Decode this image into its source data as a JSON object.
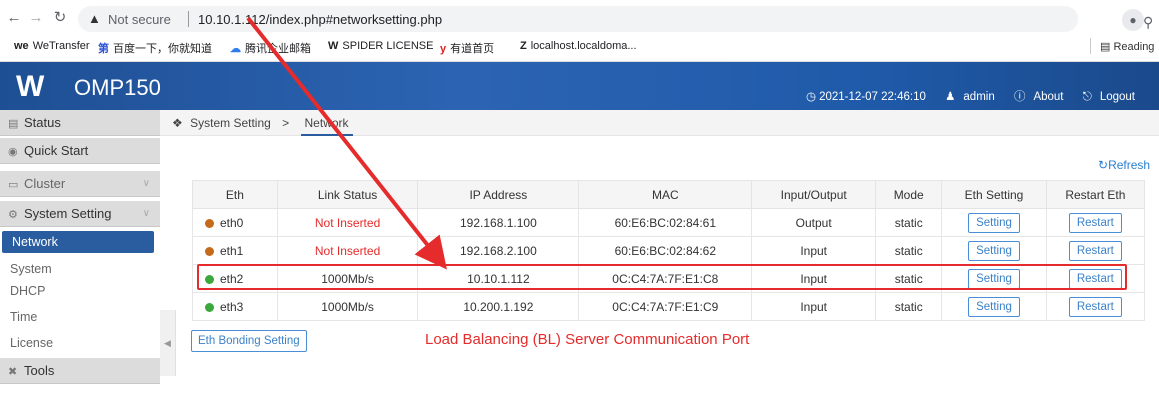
{
  "browser": {
    "not_secure_label": "Not secure",
    "url": "10.10.1.112/index.php#networksetting.php",
    "bookmarks": [
      {
        "icon": "we",
        "label": "WeTransfer"
      },
      {
        "icon": "第",
        "label": "百度一下，你就知道"
      },
      {
        "icon": "☁",
        "label": "腾讯企业邮箱"
      },
      {
        "icon": "W",
        "label": "SPIDER LICENSE"
      },
      {
        "icon": "y",
        "label": "有道首页"
      },
      {
        "icon": "Z",
        "label": "localhost.localdoma..."
      }
    ],
    "reading_list": "Reading"
  },
  "header": {
    "logo": "W",
    "product": "OMP150",
    "datetime": "2021-12-07 22:46:10",
    "user": "admin",
    "about": "About",
    "logout": "Logout"
  },
  "sidebar": {
    "status": "Status",
    "quick_start": "Quick Start",
    "cluster": "Cluster",
    "system_setting": "System Setting",
    "sub_items": [
      "Network",
      "System",
      "DHCP",
      "Time",
      "License"
    ],
    "tools": "Tools"
  },
  "breadcrumb": {
    "root": "System Setting",
    "separator": ">",
    "current": "Network"
  },
  "refresh_label": "Refresh",
  "table": {
    "headers": [
      "Eth",
      "Link Status",
      "IP Address",
      "MAC",
      "Input/Output",
      "Mode",
      "Eth Setting",
      "Restart Eth"
    ],
    "rows": [
      {
        "eth": "eth0",
        "dot_color": "#c46a1a",
        "link": "Not Inserted",
        "link_state": "down",
        "ip": "192.168.1.100",
        "mac": "60:E6:BC:02:84:61",
        "io": "Output",
        "mode": "static",
        "setting": "Setting",
        "restart": "Restart"
      },
      {
        "eth": "eth1",
        "dot_color": "#c46a1a",
        "link": "Not Inserted",
        "link_state": "down",
        "ip": "192.168.2.100",
        "mac": "60:E6:BC:02:84:62",
        "io": "Input",
        "mode": "static",
        "setting": "Setting",
        "restart": "Restart"
      },
      {
        "eth": "eth2",
        "dot_color": "#3aa83a",
        "link": "1000Mb/s",
        "link_state": "up",
        "ip": "10.10.1.112",
        "mac": "0C:C4:7A:7F:E1:C8",
        "io": "Input",
        "mode": "static",
        "setting": "Setting",
        "restart": "Restart"
      },
      {
        "eth": "eth3",
        "dot_color": "#3aa83a",
        "link": "1000Mb/s",
        "link_state": "up",
        "ip": "10.200.1.192",
        "mac": "0C:C4:7A:7F:E1:C9",
        "io": "Input",
        "mode": "static",
        "setting": "Setting",
        "restart": "Restart"
      }
    ]
  },
  "bonding_button": "Eth Bonding Setting",
  "annotation_text": "Load Balancing (BL) Server Communication Port",
  "colors": {
    "annotation": "#e52b2b",
    "accent": "#2a5d9f"
  }
}
